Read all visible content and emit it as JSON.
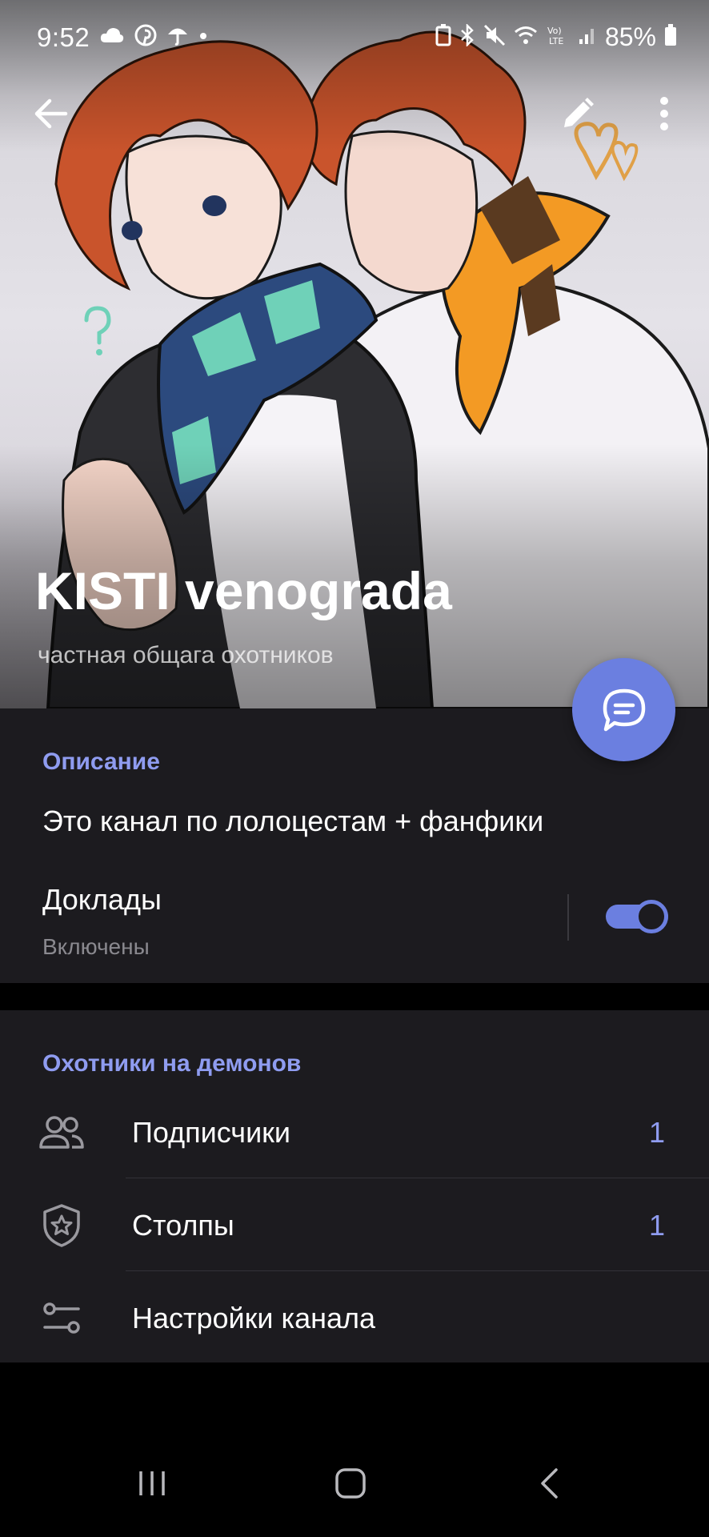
{
  "status_bar": {
    "time": "9:52",
    "battery": "85%",
    "left_icons": [
      "cloud-icon",
      "pinterest-icon",
      "umbrella-icon",
      "dot-icon"
    ],
    "right_icons": [
      "battery-saver-icon",
      "bluetooth-icon",
      "mute-icon",
      "wifi-icon",
      "volte-icon",
      "signal-icon",
      "battery-icon"
    ]
  },
  "header": {
    "title": "KISTI venograda",
    "subtitle": "частная общага охотников"
  },
  "info": {
    "description_header": "Описание",
    "description_text": "Это канал по лолоцестам + фанфики",
    "reports_title": "Доклады",
    "reports_status": "Включены",
    "reports_enabled": true
  },
  "members": {
    "header": "Охотники на демонов",
    "rows": [
      {
        "label": "Подписчики",
        "count": "1",
        "icon": "people-icon"
      },
      {
        "label": "Столпы",
        "count": "1",
        "icon": "shield-star-icon"
      },
      {
        "label": "Настройки канала",
        "count": "",
        "icon": "sliders-icon"
      }
    ]
  },
  "colors": {
    "accent": "#6b7fe0",
    "accent_text": "#8f9cf0",
    "surface": "#1c1b1f",
    "background": "#000000"
  }
}
